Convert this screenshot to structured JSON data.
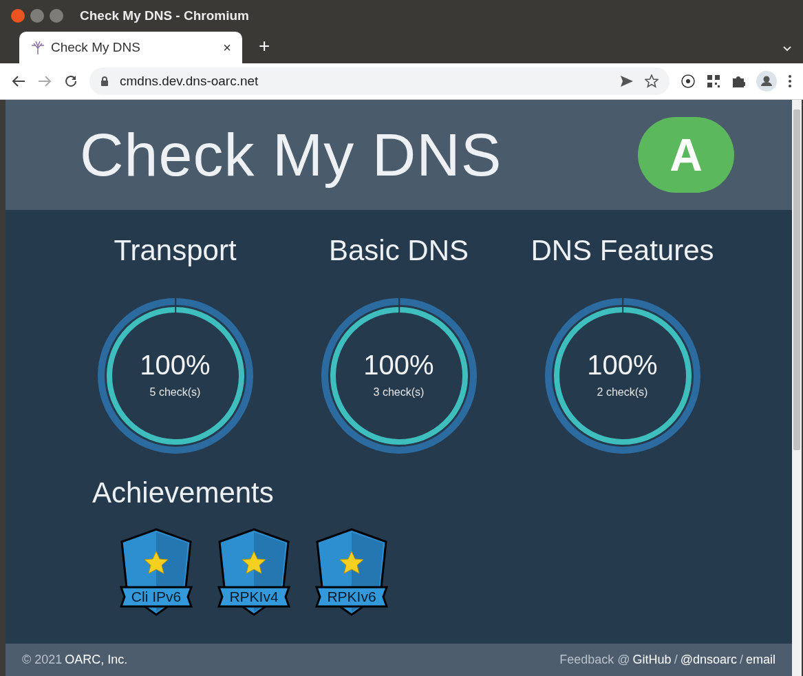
{
  "browser": {
    "window_title": "Check My DNS - Chromium",
    "tab_title": "Check My DNS",
    "tab_close": "×",
    "new_tab": "+",
    "url": "cmdns.dev.dns-oarc.net"
  },
  "header": {
    "title": "Check My DNS",
    "grade": "A"
  },
  "categories": [
    {
      "title": "Transport",
      "percent": "100%",
      "checks": "5 check(s)",
      "level": 1
    },
    {
      "title": "Basic DNS",
      "percent": "100%",
      "checks": "3 check(s)",
      "level": 1
    },
    {
      "title": "DNS Features",
      "percent": "100%",
      "checks": "2 check(s)",
      "level": 1
    }
  ],
  "achievements": {
    "title": "Achievements",
    "badges": [
      {
        "label": "Cli IPv6"
      },
      {
        "label": "RPKIv4"
      },
      {
        "label": "RPKIv6"
      }
    ]
  },
  "footer": {
    "left": [
      {
        "kind": "text",
        "text": "© 2021"
      },
      {
        "kind": "link",
        "text": "OARC, Inc."
      }
    ],
    "right": [
      {
        "kind": "text",
        "text": "Feedback @"
      },
      {
        "kind": "link",
        "text": "GitHub"
      },
      {
        "kind": "text",
        "text": "/"
      },
      {
        "kind": "link",
        "text": "@dnsoarc"
      },
      {
        "kind": "text",
        "text": "/"
      },
      {
        "kind": "link",
        "text": "email"
      }
    ]
  }
}
